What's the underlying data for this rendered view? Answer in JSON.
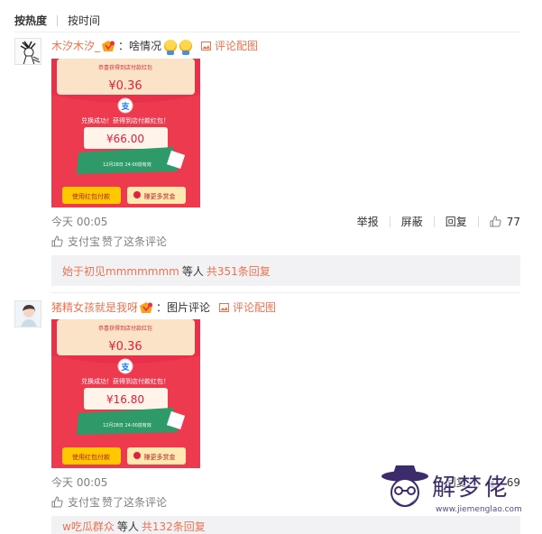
{
  "sort_tabs": {
    "hot": "按热度",
    "time": "按时间"
  },
  "comments": [
    {
      "username": "木汐木汐_",
      "text": "啥情况",
      "pic_label": "评论配图",
      "redpack": {
        "top": "恭喜获得到店付款红包",
        "small": "¥0.36",
        "success": "兑换成功！获得到店付款红包！",
        "amount": "¥66.00",
        "date": "12月28日 24:00前有效",
        "btn1": "使用红包付款",
        "btn2": "赚更多赏金"
      },
      "time": "今天 00:05",
      "actions": {
        "report": "举报",
        "block": "屏蔽",
        "reply": "回复",
        "likes": "77"
      },
      "liked_by": "支付宝",
      "liked_suffix": "赞了这条评论",
      "reply_preview": {
        "user": "始于初见mmmmmmm",
        "mid": "等人",
        "total": "共351条回复"
      }
    },
    {
      "username": "猪精女孩就是我呀",
      "text": "图片评论",
      "pic_label": "评论配图",
      "redpack": {
        "top": "恭喜获得到店付款红包",
        "small": "¥0.36",
        "success": "兑换成功！获得到店付款红包！",
        "amount": "¥16.80",
        "date": "12月28日 24:00前有效",
        "btn1": "使用红包付款",
        "btn2": "赚更多赏金"
      },
      "time": "今天 00:05",
      "actions": {
        "reply": "回复",
        "likes": "69"
      },
      "liked_by": "支付宝",
      "liked_suffix": "赞了这条评论",
      "reply_preview": {
        "user": "w吃瓜群众",
        "mid": "等人",
        "total": "共132条回复"
      }
    }
  ],
  "watermark": {
    "title": "解梦佬",
    "url": "www.jiemenglao.com"
  },
  "colors": {
    "link": "#eb7350",
    "redpack": "#e8304a",
    "gold": "#ffc800",
    "green": "#2e9a6a",
    "reply_bg": "#f2f2f5"
  },
  "icons": [
    "v-badge-icon",
    "emoji-icon",
    "image-icon",
    "thumb-up-icon",
    "alipay-logo-icon",
    "mascot-icon"
  ]
}
